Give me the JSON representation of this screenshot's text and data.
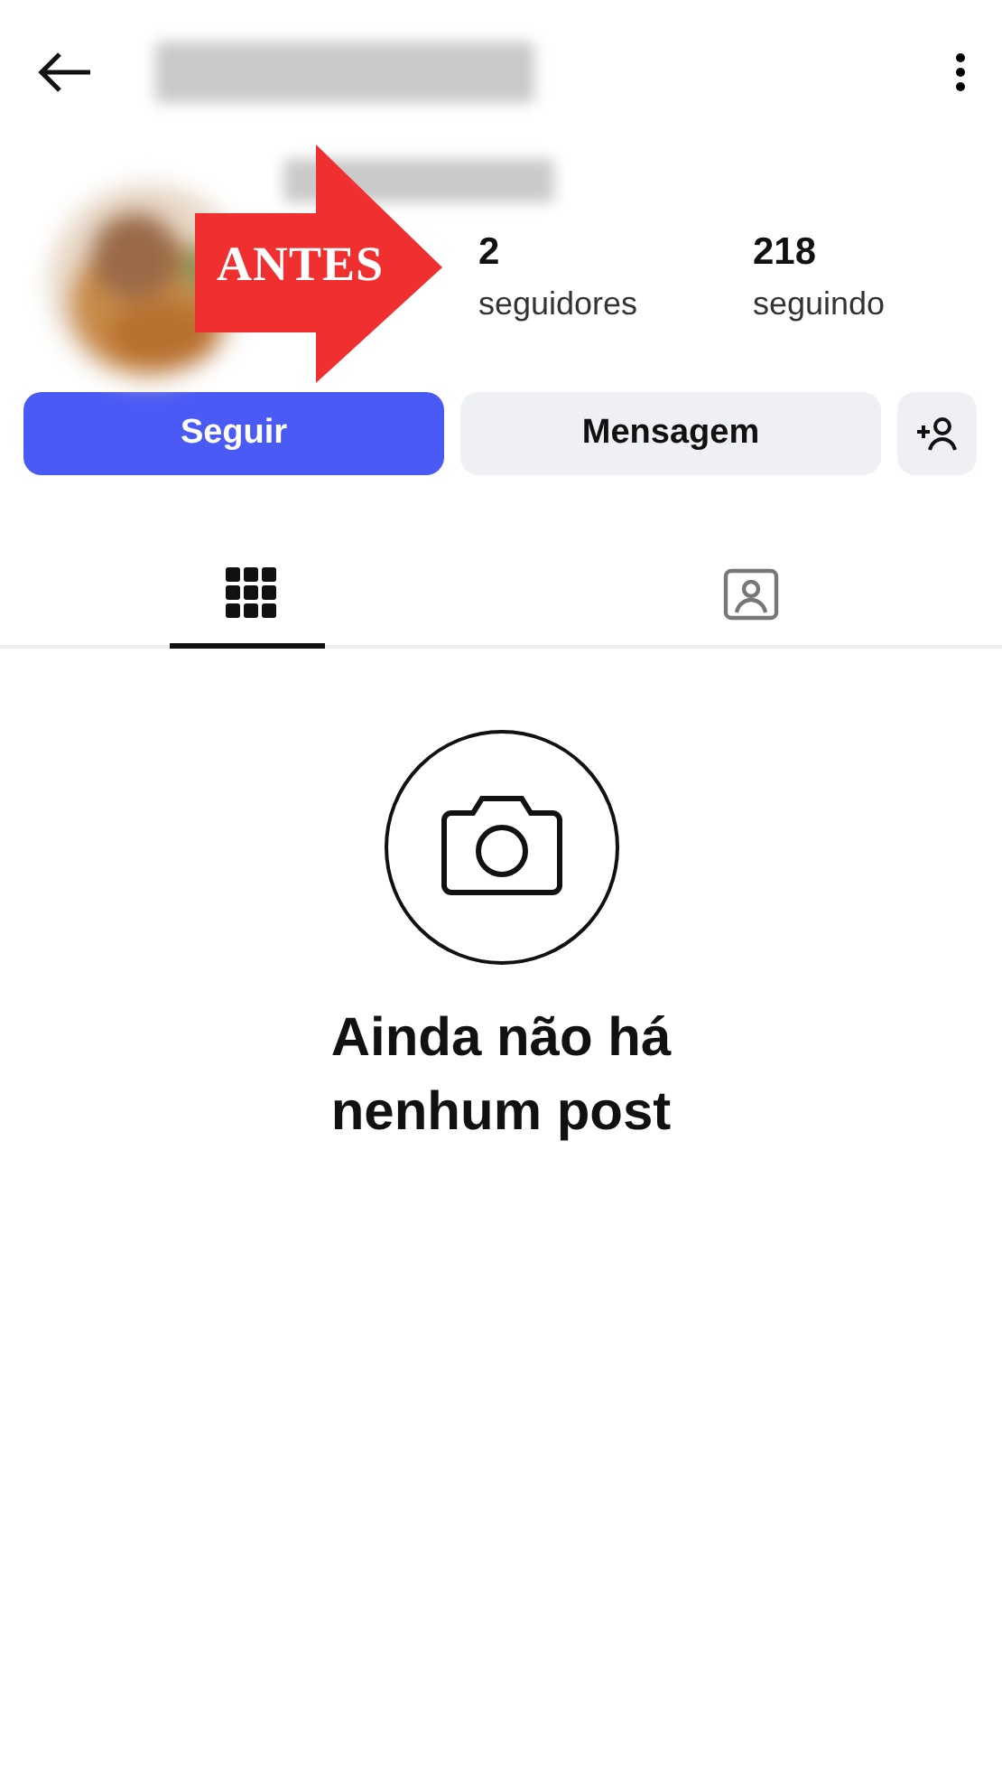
{
  "annotation": {
    "label": "ANTES"
  },
  "stats": [
    {
      "value": "2",
      "label": "seguidores"
    },
    {
      "value": "218",
      "label": "seguindo"
    }
  ],
  "buttons": [
    {
      "kind": "primary",
      "label": "Seguir"
    },
    {
      "kind": "secondary",
      "label": "Mensagem"
    },
    {
      "kind": "add-person"
    }
  ],
  "tabs": [
    {
      "kind": "grid",
      "selected": true
    },
    {
      "kind": "tagged",
      "selected": false
    }
  ],
  "empty_state": {
    "title": "Ainda não há nenhum post"
  }
}
